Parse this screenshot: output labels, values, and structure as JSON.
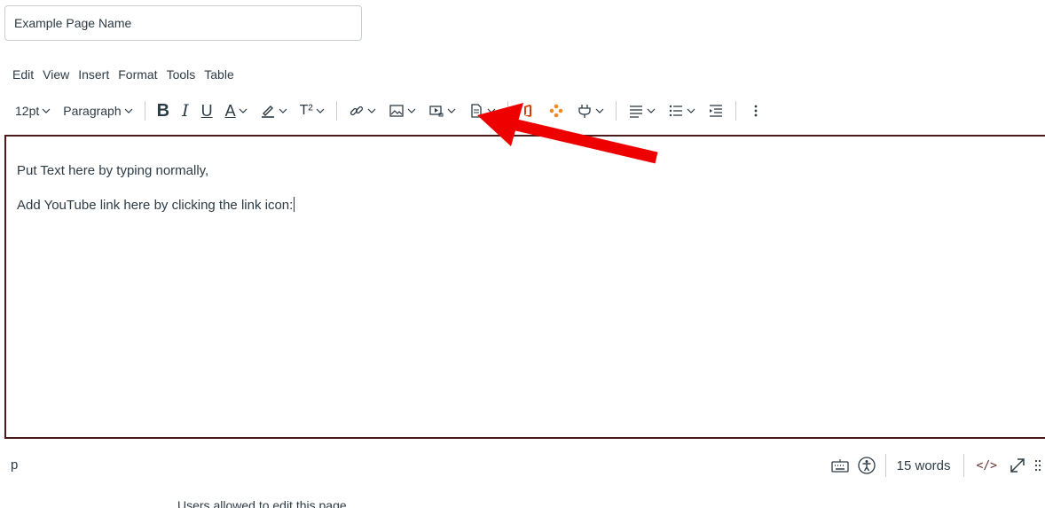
{
  "page_name": {
    "value": "Example Page Name"
  },
  "menubar": {
    "items": [
      "Edit",
      "View",
      "Insert",
      "Format",
      "Tools",
      "Table"
    ]
  },
  "toolbar": {
    "font_size": "12pt",
    "block_format": "Paragraph",
    "bold": "B",
    "italic": "I",
    "underline": "U",
    "text_color": "A",
    "superscript": "T²"
  },
  "editor": {
    "line1": "Put Text here by typing normally,",
    "line2": "Add YouTube link here by clicking the link icon:"
  },
  "statusbar": {
    "path": "p",
    "word_count": "15 words",
    "html_toggle": "</>"
  },
  "footer": {
    "text": "Users allowed to edit this page"
  },
  "colors": {
    "editor_border": "#4a1a1a",
    "office_icon": "#d83b01",
    "apps_icon": "#f08a24",
    "annotation_arrow": "#ee0000"
  }
}
